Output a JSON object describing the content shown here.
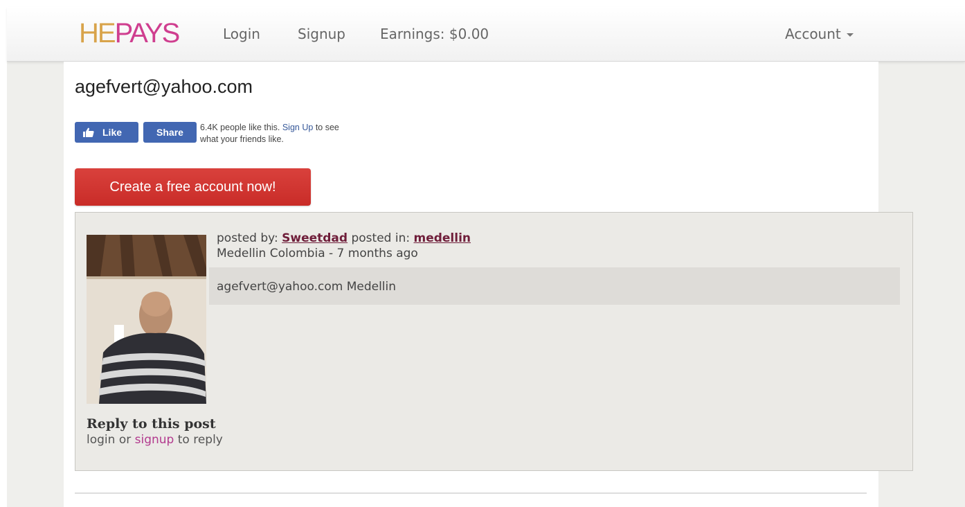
{
  "brand": {
    "part1": "HE",
    "part2": "PAYS"
  },
  "nav": {
    "login": "Login",
    "signup": "Signup",
    "earnings": "Earnings: $0.00",
    "account": "Account"
  },
  "page": {
    "title": "agefvert@yahoo.com"
  },
  "facebook": {
    "like_label": "Like",
    "share_label": "Share",
    "count_text": "6.4K people like this.",
    "signup_link": "Sign Up",
    "suffix": "to see",
    "line2": "what your friends like."
  },
  "cta": {
    "label": "Create a free account now!"
  },
  "post": {
    "posted_by_label": "posted by:",
    "author": "Sweetdad",
    "posted_in_label": "posted in:",
    "category": "medellin",
    "location_time": "Medellin Colombia - 7 months ago",
    "message": "agefvert@yahoo.com Medellin",
    "reply_heading": "Reply to this post",
    "reply_login": "login or",
    "reply_signup": "signup",
    "reply_suffix": "to reply"
  },
  "colors": {
    "accent_red": "#d0312d",
    "facebook_blue": "#4267b2",
    "brand_gold": "#d8a34a",
    "brand_pink": "#cf3e8f",
    "link_maroon": "#6f1e3a"
  }
}
